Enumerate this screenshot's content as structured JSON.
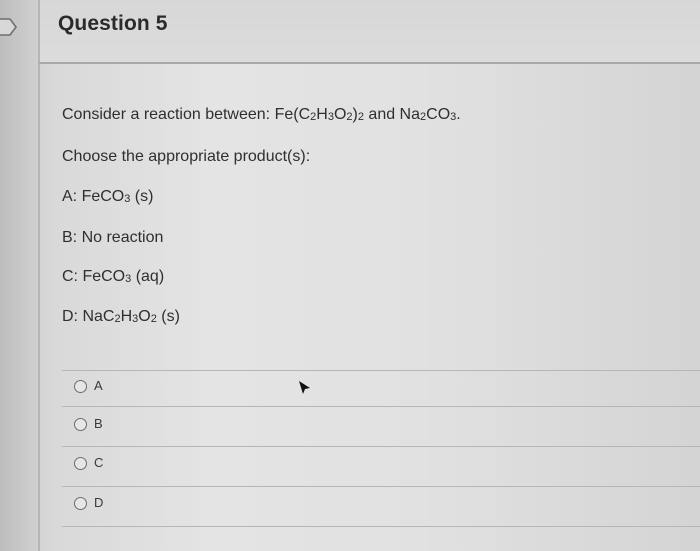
{
  "question": {
    "title": "Question 5",
    "prompt": {
      "prefix": "Consider a reaction between: Fe(C",
      "p1": "2",
      "m1": "H",
      "p2": "3",
      "m2": "O",
      "p3": "2",
      "m3": ")",
      "p4": "2",
      "mid": " and Na",
      "p5": "2",
      "m4": "CO",
      "p6": "3",
      "end": "."
    },
    "instruction": "Choose the appropriate product(s):",
    "options": [
      {
        "letter": "A: FeCO",
        "sub": "3",
        "rest": " (s)"
      },
      {
        "letter": "B: No reaction"
      },
      {
        "letter": "C: FeCO",
        "sub": "3",
        "rest": " (aq)"
      },
      {
        "letter": "D: NaC",
        "s1": "2",
        "t1": "H",
        "s2": "3",
        "t2": "O",
        "s3": "2",
        "rest": " (s)"
      }
    ],
    "answers": [
      "A",
      "B",
      "C",
      "D"
    ]
  },
  "icons": {
    "flag": "flag-icon",
    "pointer": "mouse-pointer-icon",
    "radio": "radio-button-icon"
  }
}
